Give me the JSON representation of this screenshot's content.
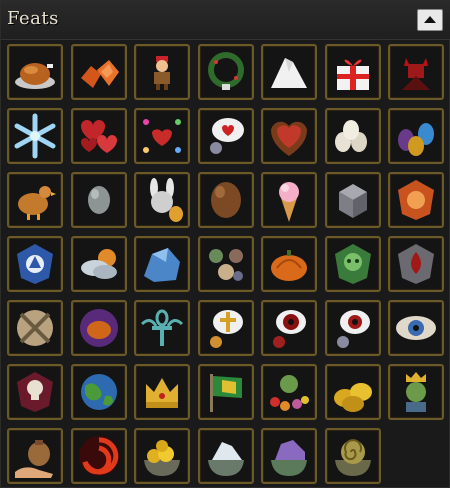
{
  "panel": {
    "title": "Feats"
  },
  "feats": [
    "roast-chicken-icon",
    "orange-gems-icon",
    "elf-figurine-icon",
    "holiday-wreath-icon",
    "snow-pile-icon",
    "gift-box-icon",
    "red-devil-icon",
    "snowflake-icon",
    "hearts-cluster-icon",
    "valentine-sticker-sheet-icon",
    "heart-speech-bubble-icon",
    "chocolate-heart-box-icon",
    "eggs-pile-icon",
    "easter-eggs-icon",
    "hen-icon",
    "gray-egg-icon",
    "bunny-costume-icon",
    "chocolate-egg-icon",
    "ice-cream-cone-icon",
    "stone-cube-icon",
    "orange-shield-emblem-icon",
    "blue-shield-emblem-icon",
    "cloud-sun-icon",
    "blue-crystal-rock-icon",
    "monster-portraits-icon",
    "pumpkin-pile-icon",
    "green-skull-emblem-icon",
    "red-blood-emblem-icon",
    "crossed-swords-shield-icon",
    "purple-pumpkin-icon",
    "winged-ankh-icon",
    "holy-cross-bubble-icon",
    "red-eye-bubble-icon",
    "eye-thought-bubble-icon",
    "winged-eye-emblem-icon",
    "skull-emblem-icon",
    "earth-globe-icon",
    "gold-crown-icon",
    "green-flag-icon",
    "goblin-bouquet-icon",
    "gold-coins-icon",
    "goblin-king-icon",
    "money-bag-hand-icon",
    "red-vortex-icon",
    "gold-pile-bowl-icon",
    "silver-pile-bowl-icon",
    "purple-pile-bowl-icon",
    "gold-spiral-bowl-icon"
  ],
  "colors": {
    "tile_border": "#6b5a28",
    "tile_bg": "#141414",
    "panel_bg": "#1a1a1a",
    "title_text": "#e8e2d0"
  }
}
